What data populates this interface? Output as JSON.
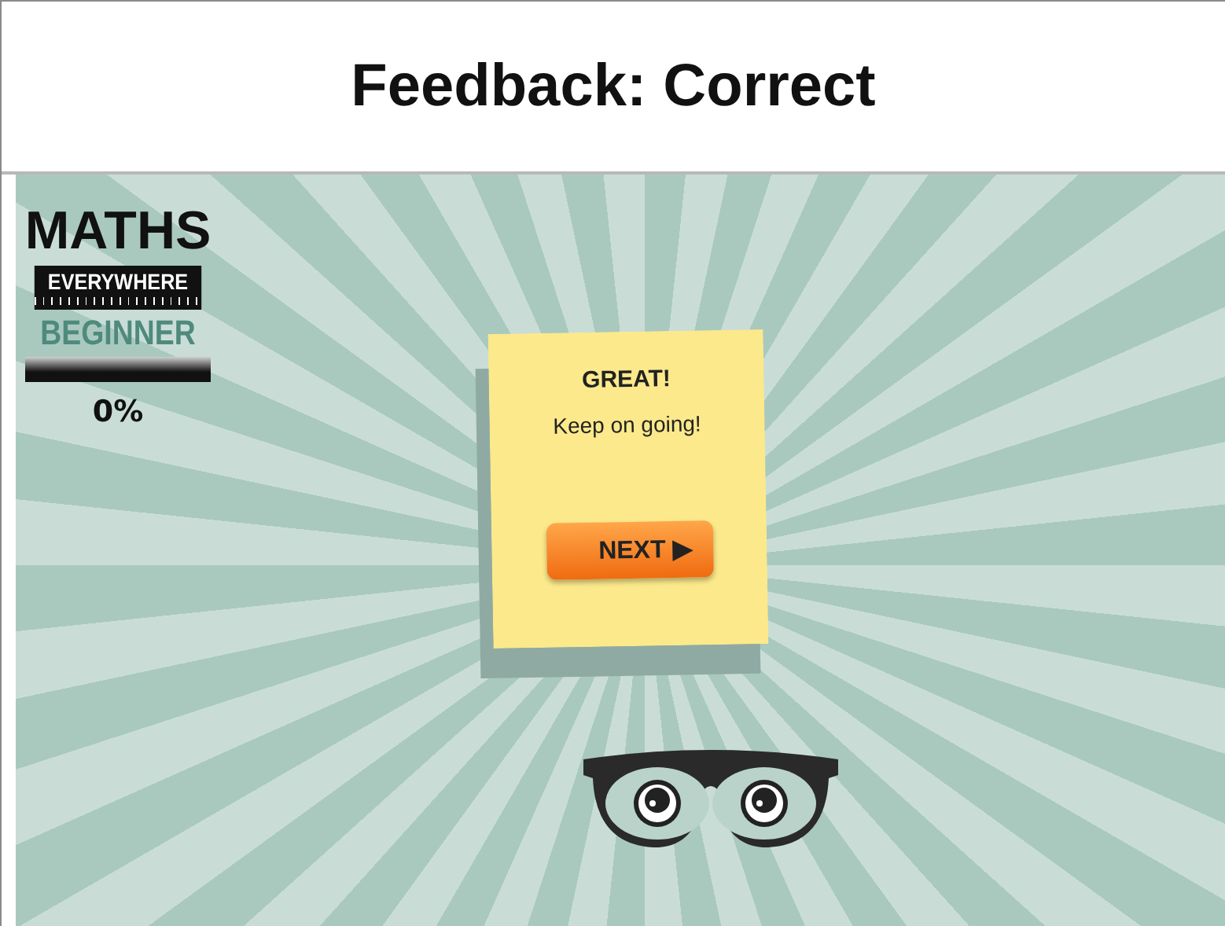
{
  "slide": {
    "title": "Feedback: Correct"
  },
  "logo": {
    "line_1": "MATHS",
    "line_2": "EVERYWHERE",
    "level_name": "BEGINNER"
  },
  "progress": {
    "reading": "0%",
    "level": 0
  },
  "feedback_note": {
    "heading": "GREAT!",
    "message": "Keep on going!",
    "button": "NEXT ▶"
  }
}
